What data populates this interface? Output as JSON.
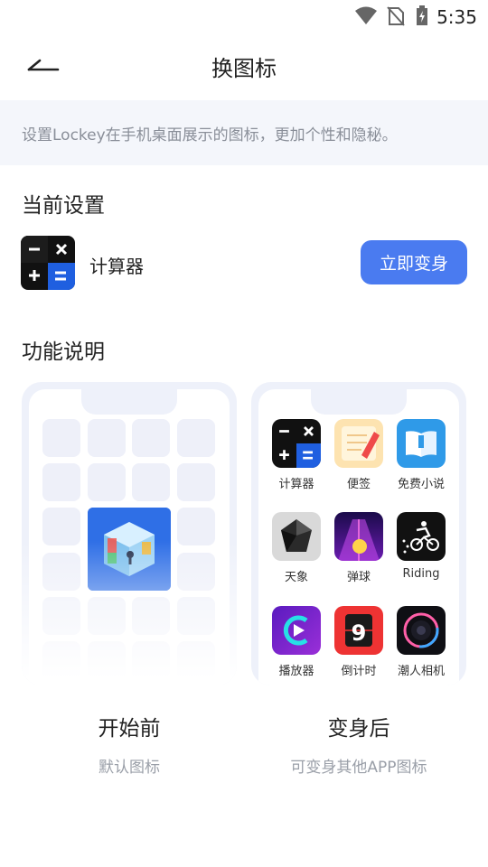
{
  "status_bar": {
    "time": "5:35"
  },
  "header": {
    "title": "换图标"
  },
  "notice": {
    "text": "设置Lockey在手机桌面展示的图标，更加个性和隐秘。"
  },
  "current": {
    "section_title": "当前设置",
    "app_name": "计算器",
    "button_label": "立即变身"
  },
  "features": {
    "section_title": "功能说明",
    "before": {
      "title": "开始前",
      "subtitle": "默认图标"
    },
    "after": {
      "title": "变身后",
      "subtitle": "可变身其他APP图标",
      "apps": [
        {
          "label": "计算器",
          "icon": "calculator-icon"
        },
        {
          "label": "便签",
          "icon": "notes-icon"
        },
        {
          "label": "免费小说",
          "icon": "book-icon"
        },
        {
          "label": "天象",
          "icon": "crystal-icon"
        },
        {
          "label": "弹球",
          "icon": "ball-game-icon"
        },
        {
          "label": "Riding",
          "icon": "bike-icon"
        },
        {
          "label": "播放器",
          "icon": "player-icon"
        },
        {
          "label": "倒计时",
          "icon": "countdown-icon"
        },
        {
          "label": "潮人相机",
          "icon": "camera-icon"
        }
      ]
    }
  },
  "colors": {
    "accent": "#4a7bf0",
    "notice_bg": "#f4f6fb",
    "muted_text": "#8a8f99"
  }
}
